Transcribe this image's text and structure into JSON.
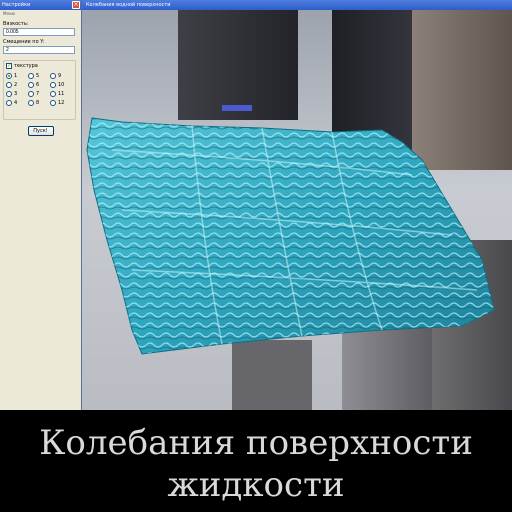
{
  "settings": {
    "title": "Настройки",
    "menu": "Меню",
    "viscosity_label": "Вязкость:",
    "viscosity_value": "0.005",
    "offset_label": "Смещение по Y:",
    "offset_value": "2",
    "texture_label": "текстура",
    "texture_checked": true,
    "radio_options": [
      "1",
      "5",
      "9",
      "2",
      "6",
      "10",
      "3",
      "7",
      "11",
      "4",
      "8",
      "12"
    ],
    "radio_selected": "1",
    "start_label": "Пуск!"
  },
  "render": {
    "title": "Колебания водной поверхности"
  },
  "caption": {
    "line1": "Колебания поверхности",
    "line2": "жидкости"
  },
  "colors": {
    "water": "#2fa7c0",
    "titlebar": "#2d5ec9",
    "dialog_bg": "#ece9d8"
  }
}
